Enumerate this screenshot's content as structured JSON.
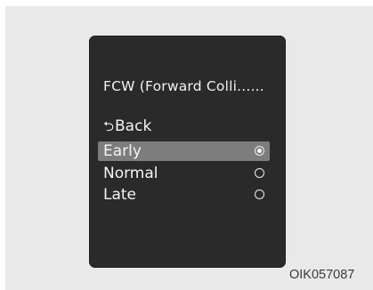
{
  "menu": {
    "title": "FCW (Forward Colli......",
    "back_label": "Back",
    "options": [
      {
        "label": "Early",
        "selected": true
      },
      {
        "label": "Normal",
        "selected": false
      },
      {
        "label": "Late",
        "selected": false
      }
    ]
  },
  "figure_code": "OIK057087"
}
